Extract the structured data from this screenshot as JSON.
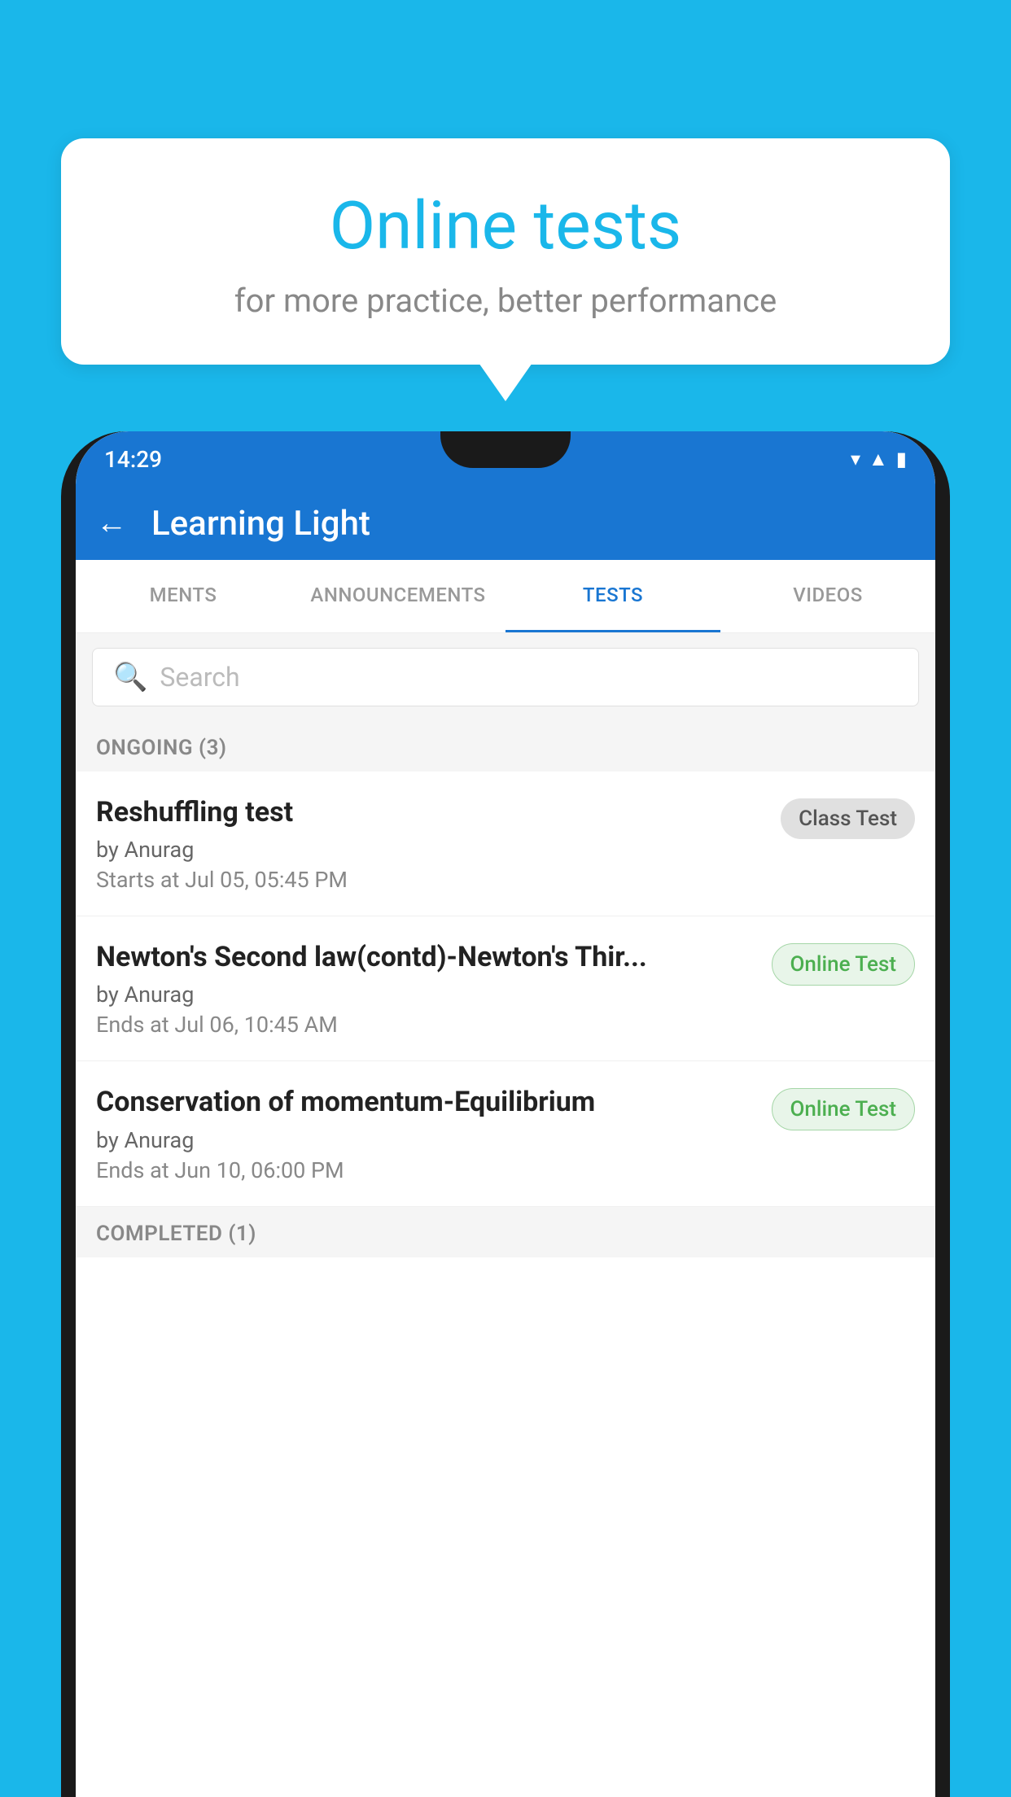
{
  "background": {
    "color": "#1ab7ea"
  },
  "speech_bubble": {
    "title": "Online tests",
    "subtitle": "for more practice, better performance"
  },
  "phone": {
    "status_bar": {
      "time": "14:29",
      "icons": [
        "wifi",
        "signal",
        "battery"
      ]
    },
    "app_bar": {
      "title": "Learning Light",
      "back_label": "←"
    },
    "tabs": [
      {
        "label": "MENTS",
        "active": false
      },
      {
        "label": "ANNOUNCEMENTS",
        "active": false
      },
      {
        "label": "TESTS",
        "active": true
      },
      {
        "label": "VIDEOS",
        "active": false
      }
    ],
    "search": {
      "placeholder": "Search"
    },
    "sections": [
      {
        "title": "ONGOING (3)",
        "items": [
          {
            "name": "Reshuffling test",
            "author": "by Anurag",
            "date_label": "Starts at",
            "date": "Jul 05, 05:45 PM",
            "badge": "Class Test",
            "badge_type": "gray"
          },
          {
            "name": "Newton's Second law(contd)-Newton's Thir...",
            "author": "by Anurag",
            "date_label": "Ends at",
            "date": "Jul 06, 10:45 AM",
            "badge": "Online Test",
            "badge_type": "green"
          },
          {
            "name": "Conservation of momentum-Equilibrium",
            "author": "by Anurag",
            "date_label": "Ends at",
            "date": "Jun 10, 06:00 PM",
            "badge": "Online Test",
            "badge_type": "green"
          }
        ]
      },
      {
        "title": "COMPLETED (1)",
        "items": []
      }
    ]
  }
}
